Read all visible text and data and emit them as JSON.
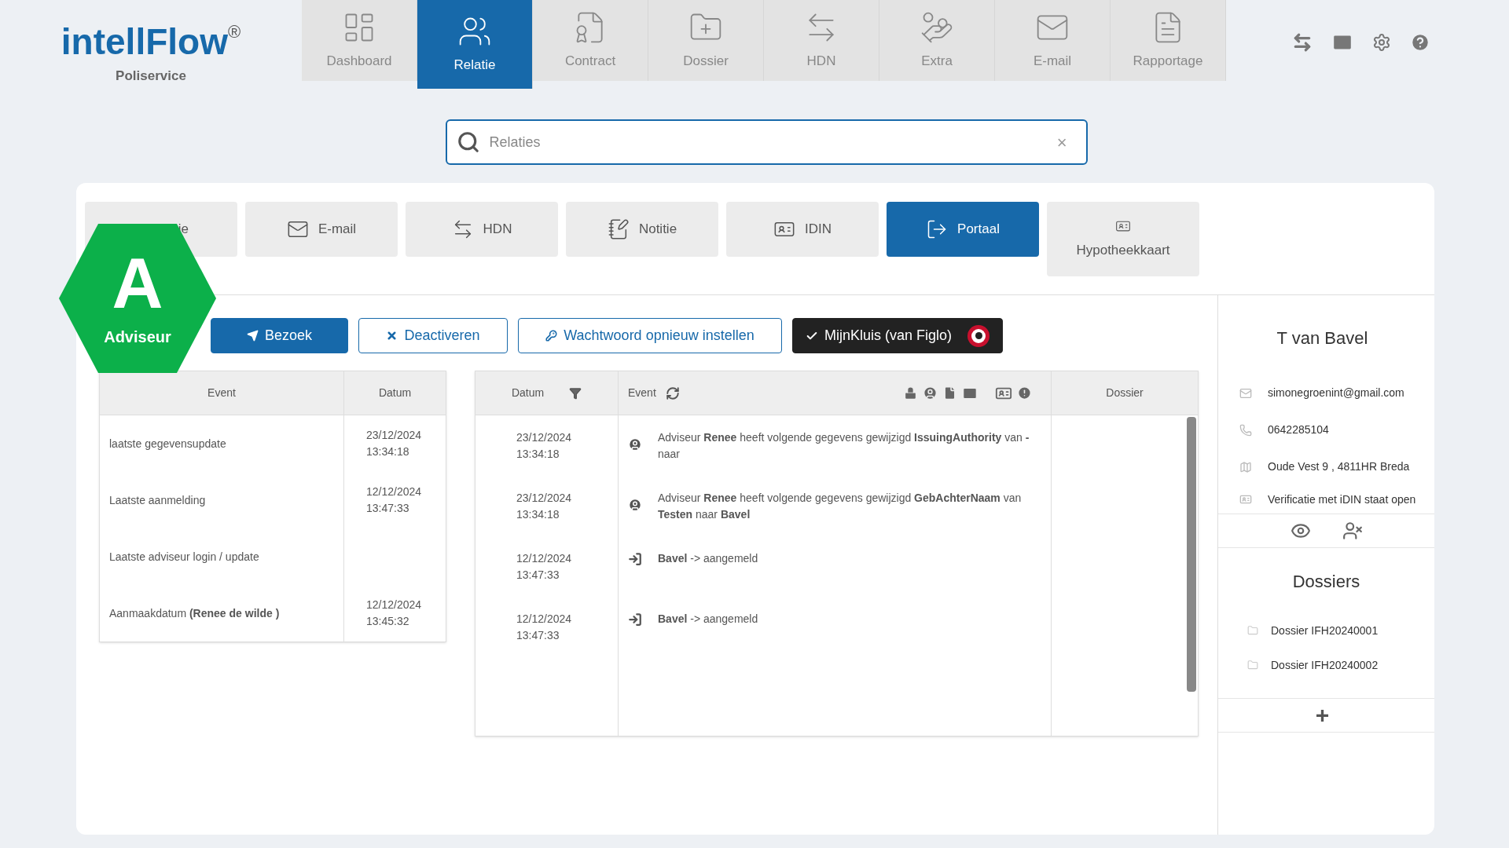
{
  "logo": {
    "name": "intellFlow",
    "mark": "®",
    "subtitle": "Poliservice"
  },
  "nav": [
    {
      "label": "Dashboard",
      "kind": "dashboard",
      "selected": false
    },
    {
      "label": "Relatie",
      "kind": "relatie",
      "selected": true
    },
    {
      "label": "Contract",
      "kind": "contract",
      "selected": false
    },
    {
      "label": "Dossier",
      "kind": "dossier",
      "selected": false
    },
    {
      "label": "HDN",
      "kind": "hdn",
      "selected": false
    },
    {
      "label": "Extra",
      "kind": "extra",
      "selected": false
    },
    {
      "label": "E-mail",
      "kind": "email",
      "selected": false
    },
    {
      "label": "Rapportage",
      "kind": "rapportage",
      "selected": false
    }
  ],
  "search": {
    "placeholder": "Relaties",
    "clear": "×"
  },
  "subtabs": [
    {
      "label": "ie",
      "kind": "relatie",
      "selected": false
    },
    {
      "label": "E-mail",
      "kind": "email",
      "selected": false
    },
    {
      "label": "HDN",
      "kind": "hdn",
      "selected": false
    },
    {
      "label": "Notitie",
      "kind": "note",
      "selected": false
    },
    {
      "label": "IDIN",
      "kind": "idcard",
      "selected": false
    },
    {
      "label": "Portaal",
      "kind": "portal",
      "selected": true
    },
    {
      "label": "Hypotheekkaart",
      "kind": "idcard",
      "selected": false
    }
  ],
  "badge": {
    "letter": "A",
    "label": "Adviseur"
  },
  "actions": [
    {
      "label": "Bezoek",
      "kind": "primary"
    },
    {
      "label": "Deactiveren",
      "kind": "outline"
    },
    {
      "label": "Wachtwoord opnieuw instellen",
      "kind": "outline"
    },
    {
      "label": "MijnKluis (van Figlo)",
      "kind": "dark"
    }
  ],
  "login_table": {
    "columns": [
      "Event",
      "Datum"
    ],
    "rows": [
      {
        "event": "laatste gegevensupdate",
        "date": "23/12/2024",
        "time": "13:34:18"
      },
      {
        "event": "Laatste aanmelding",
        "date": "12/12/2024",
        "time": "13:47:33"
      },
      {
        "event": "Laatste adviseur login / update"
      },
      {
        "event": "Aanmaakdatum **(Renee de wilde )**",
        "date": "12/12/2024",
        "time": "13:45:32"
      }
    ]
  },
  "event_table": {
    "columns": [
      "Datum",
      "Event",
      "Dossier"
    ],
    "rows": [
      {
        "date": "23/12/2024",
        "time": "13:34:18",
        "kind": "user",
        "text": "Adviseur **Renee** heeft volgende gegevens gewijzigd **IssuingAuthority** van **-** naar"
      },
      {
        "date": "23/12/2024",
        "time": "13:34:18",
        "kind": "user",
        "text": "Adviseur **Renee** heeft volgende gegevens gewijzigd **GebAchterNaam** van **Testen** naar **Bavel**"
      },
      {
        "date": "12/12/2024",
        "time": "13:47:33",
        "kind": "login",
        "text": "**Bavel** -> aangemeld"
      },
      {
        "date": "12/12/2024",
        "time": "13:47:33",
        "kind": "login",
        "text": "**Bavel** -> aangemeld"
      }
    ]
  },
  "contact": {
    "name": "T van Bavel",
    "items": [
      {
        "kind": "email",
        "text": "simonegroenint@gmail.com"
      },
      {
        "kind": "phone",
        "text": "0642285104"
      },
      {
        "kind": "address",
        "text": "Oude Vest 9 , 4811HR Breda"
      },
      {
        "kind": "idin",
        "text": "Verificatie met iDIN staat open"
      }
    ]
  },
  "dossiers": {
    "title": "Dossiers",
    "items": [
      "Dossier IFH20240001",
      "Dossier IFH20240002"
    ],
    "add": "+"
  }
}
